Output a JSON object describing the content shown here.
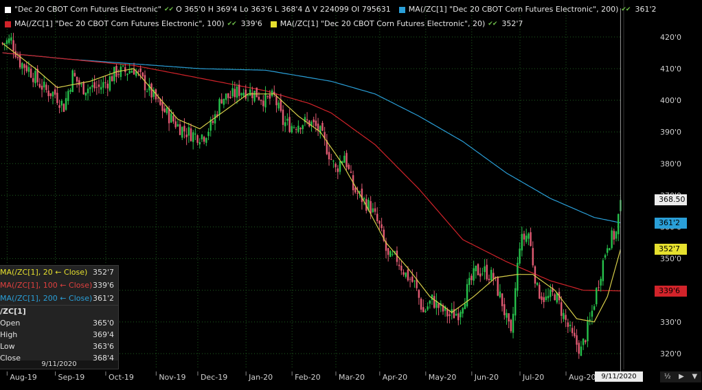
{
  "legend": {
    "main_name": "\"Dec 20 CBOT Corn Futures Electronic\"",
    "ohlc_text": "O 365'0  H 369'4  Lo 363'6  L 368'4  Δ    V 224099  OI 795631",
    "ma200_label": "MA(/ZC[1] \"Dec 20 CBOT Corn Futures Electronic\", 200)",
    "ma200_value": "361'2",
    "ma100_label": "MA(/ZC[1] \"Dec 20 CBOT Corn Futures Electronic\", 100)",
    "ma100_value": "339'6",
    "ma20_label": "MA(/ZC[1] \"Dec 20 CBOT Corn Futures Electronic\", 20)",
    "ma20_value": "352'7",
    "check": "✔✔"
  },
  "colors": {
    "background": "#000000",
    "grid": "#1f5f1f",
    "up": "#27c24c",
    "down": "#e25b73",
    "ma20": "#d9d04a",
    "ma100": "#d2232a",
    "ma200": "#2a9fd8",
    "last_price": "#ececec"
  },
  "price_tags": [
    {
      "price": 368.5,
      "text": "368.50",
      "bg": "#ececec",
      "fg": "#000000"
    },
    {
      "price": 361.25,
      "text": "361'2",
      "bg": "#2a9fd8",
      "fg": "#000000"
    },
    {
      "price": 352.875,
      "text": "352'7",
      "bg": "#e6e02e",
      "fg": "#000000"
    },
    {
      "price": 339.75,
      "text": "339'6",
      "bg": "#d2232a",
      "fg": "#000000"
    }
  ],
  "infobox": {
    "rows": [
      {
        "label": "MA(/ZC[1], 20 ← Close)",
        "value": "352'7",
        "color": "#e6e02e"
      },
      {
        "label": "MA(/ZC[1], 100 ← Close)",
        "value": "339'6",
        "color": "#e0403f"
      },
      {
        "label": "MA(/ZC[1], 200 ← Close)",
        "value": "361'2",
        "color": "#2a9fd8"
      }
    ],
    "symbol": "/ZC[1]",
    "ohlc": [
      {
        "label": "Open",
        "value": "365'0"
      },
      {
        "label": "High",
        "value": "369'4"
      },
      {
        "label": "Low",
        "value": "363'6"
      },
      {
        "label": "Close",
        "value": "368'4"
      }
    ],
    "date": "9/11/2020"
  },
  "crosshair_date": "9/11/2020",
  "controls": {
    "zoom": "½",
    "arrow": "▶",
    "menu": "▼"
  },
  "chart_data": {
    "type": "candlestick",
    "ylim": [
      315,
      423
    ],
    "y_ticks": [
      320,
      330,
      340,
      350,
      360,
      370,
      380,
      390,
      400,
      410,
      420
    ],
    "y_tick_labels": [
      "320'0",
      "330'0",
      "340'0",
      "350'0",
      "360'0",
      "370'0",
      "380'0",
      "390'0",
      "400'0",
      "410'0",
      "420'0"
    ],
    "x_labels": [
      {
        "day": 4,
        "label": "Aug-19"
      },
      {
        "day": 26,
        "label": "Sep-19"
      },
      {
        "day": 49,
        "label": "Oct-19"
      },
      {
        "day": 72,
        "label": "Nov-19"
      },
      {
        "day": 91,
        "label": "Dec-19"
      },
      {
        "day": 113,
        "label": "Jan-20"
      },
      {
        "day": 134,
        "label": "Feb-20"
      },
      {
        "day": 154,
        "label": "Mar-20"
      },
      {
        "day": 174,
        "label": "Apr-20"
      },
      {
        "day": 195,
        "label": "May-20"
      },
      {
        "day": 216,
        "label": "Jun-20"
      },
      {
        "day": 238,
        "label": "Jul-20"
      },
      {
        "day": 259,
        "label": "Aug-20"
      }
    ],
    "last_day": 282,
    "close_anchors": [
      [
        0,
        418
      ],
      [
        4,
        419
      ],
      [
        8,
        412
      ],
      [
        12,
        410
      ],
      [
        16,
        406
      ],
      [
        20,
        403
      ],
      [
        24,
        402
      ],
      [
        28,
        398
      ],
      [
        32,
        408
      ],
      [
        36,
        404
      ],
      [
        40,
        404
      ],
      [
        44,
        404
      ],
      [
        48,
        406
      ],
      [
        52,
        409
      ],
      [
        56,
        409
      ],
      [
        60,
        410
      ],
      [
        64,
        406
      ],
      [
        68,
        402
      ],
      [
        72,
        398
      ],
      [
        76,
        395
      ],
      [
        80,
        392
      ],
      [
        84,
        390
      ],
      [
        88,
        389
      ],
      [
        92,
        389
      ],
      [
        96,
        393
      ],
      [
        100,
        401
      ],
      [
        104,
        401
      ],
      [
        108,
        403
      ],
      [
        112,
        403
      ],
      [
        116,
        402
      ],
      [
        120,
        400
      ],
      [
        124,
        401
      ],
      [
        128,
        393
      ],
      [
        132,
        392
      ],
      [
        136,
        393
      ],
      [
        140,
        393
      ],
      [
        144,
        391
      ],
      [
        148,
        385
      ],
      [
        152,
        378
      ],
      [
        156,
        383
      ],
      [
        160,
        372
      ],
      [
        164,
        369
      ],
      [
        168,
        366
      ],
      [
        172,
        360
      ],
      [
        176,
        350
      ],
      [
        180,
        350
      ],
      [
        184,
        345
      ],
      [
        188,
        342
      ],
      [
        192,
        333
      ],
      [
        196,
        337
      ],
      [
        200,
        334
      ],
      [
        204,
        332
      ],
      [
        208,
        333
      ],
      [
        212,
        340
      ],
      [
        216,
        346
      ],
      [
        220,
        346
      ],
      [
        224,
        344
      ],
      [
        228,
        336
      ],
      [
        232,
        325
      ],
      [
        236,
        355
      ],
      [
        240,
        358
      ],
      [
        244,
        340
      ],
      [
        248,
        337
      ],
      [
        252,
        339
      ],
      [
        256,
        332
      ],
      [
        260,
        325
      ],
      [
        264,
        321
      ],
      [
        268,
        330
      ],
      [
        272,
        343
      ],
      [
        276,
        355
      ],
      [
        280,
        358
      ],
      [
        282,
        368
      ]
    ],
    "ma200_anchors": [
      [
        0,
        415
      ],
      [
        30,
        413
      ],
      [
        60,
        411.5
      ],
      [
        90,
        410
      ],
      [
        120,
        409.5
      ],
      [
        150,
        406
      ],
      [
        170,
        402
      ],
      [
        190,
        395
      ],
      [
        210,
        387
      ],
      [
        230,
        377
      ],
      [
        250,
        369
      ],
      [
        270,
        363
      ],
      [
        282,
        361.3
      ]
    ],
    "ma100_anchors": [
      [
        0,
        415
      ],
      [
        30,
        413
      ],
      [
        60,
        411
      ],
      [
        90,
        407
      ],
      [
        120,
        403
      ],
      [
        140,
        399
      ],
      [
        150,
        396
      ],
      [
        170,
        386
      ],
      [
        190,
        372
      ],
      [
        210,
        356
      ],
      [
        230,
        349
      ],
      [
        250,
        343
      ],
      [
        265,
        340
      ],
      [
        282,
        339.8
      ]
    ],
    "ma20_anchors": [
      [
        0,
        418
      ],
      [
        15,
        410
      ],
      [
        25,
        404
      ],
      [
        40,
        406
      ],
      [
        52,
        409
      ],
      [
        60,
        410
      ],
      [
        70,
        402
      ],
      [
        80,
        394
      ],
      [
        90,
        391
      ],
      [
        100,
        396
      ],
      [
        112,
        402
      ],
      [
        124,
        402
      ],
      [
        135,
        395
      ],
      [
        145,
        390
      ],
      [
        155,
        380
      ],
      [
        165,
        368
      ],
      [
        175,
        355
      ],
      [
        185,
        347
      ],
      [
        195,
        338
      ],
      [
        205,
        333
      ],
      [
        215,
        338
      ],
      [
        225,
        344
      ],
      [
        235,
        345
      ],
      [
        242,
        345
      ],
      [
        252,
        340
      ],
      [
        262,
        331
      ],
      [
        270,
        330
      ],
      [
        276,
        338
      ],
      [
        282,
        352.9
      ]
    ],
    "last_close": 368.5,
    "last_open": 365.0,
    "last_high": 369.5,
    "last_low": 363.75
  }
}
